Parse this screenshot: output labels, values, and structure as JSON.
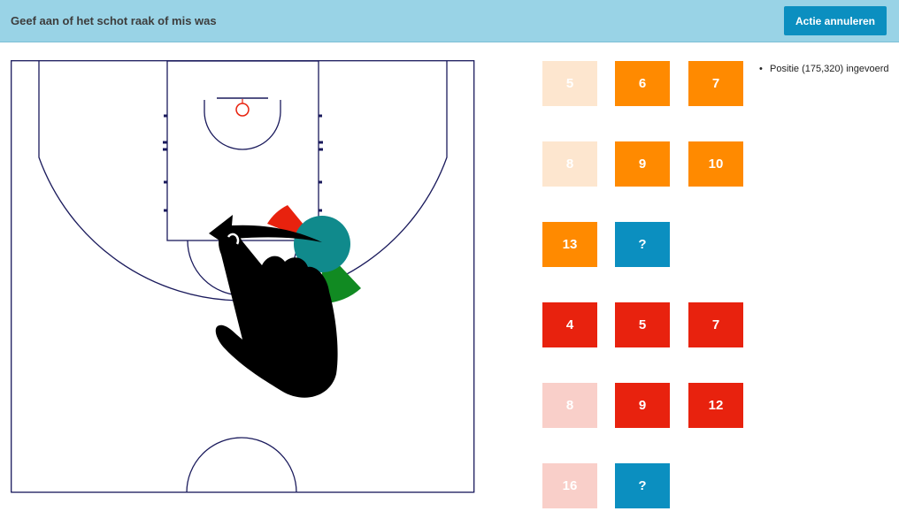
{
  "header": {
    "title": "Geef aan of het schot raak of mis was",
    "cancel_label": "Actie annuleren"
  },
  "colors": {
    "header_bg": "#99d3e6",
    "button": "#0b8fc0",
    "made": "#ff8a00",
    "made_faded": "#fde6cf",
    "missed": "#e8220e",
    "missed_faded": "#f9cfc9",
    "unknown": "#0b8fc0",
    "court_line": "#1a1a5c"
  },
  "shot_tiles_made": [
    {
      "label": "5",
      "state": "faded"
    },
    {
      "label": "6",
      "state": "active"
    },
    {
      "label": "7",
      "state": "active"
    },
    {
      "label": "8",
      "state": "faded"
    },
    {
      "label": "9",
      "state": "active"
    },
    {
      "label": "10",
      "state": "active"
    },
    {
      "label": "13",
      "state": "active"
    },
    {
      "label": "?",
      "state": "unknown"
    }
  ],
  "shot_tiles_missed": [
    {
      "label": "4",
      "state": "active"
    },
    {
      "label": "5",
      "state": "active"
    },
    {
      "label": "7",
      "state": "active"
    },
    {
      "label": "8",
      "state": "faded"
    },
    {
      "label": "9",
      "state": "active"
    },
    {
      "label": "12",
      "state": "active"
    },
    {
      "label": "16",
      "state": "faded"
    },
    {
      "label": "?",
      "state": "unknown"
    }
  ],
  "log": {
    "entries": [
      "Positie (175,320) ingevoerd"
    ]
  },
  "court": {
    "icons": [
      "hand-pointer-icon",
      "swipe-arrow-icon"
    ]
  }
}
